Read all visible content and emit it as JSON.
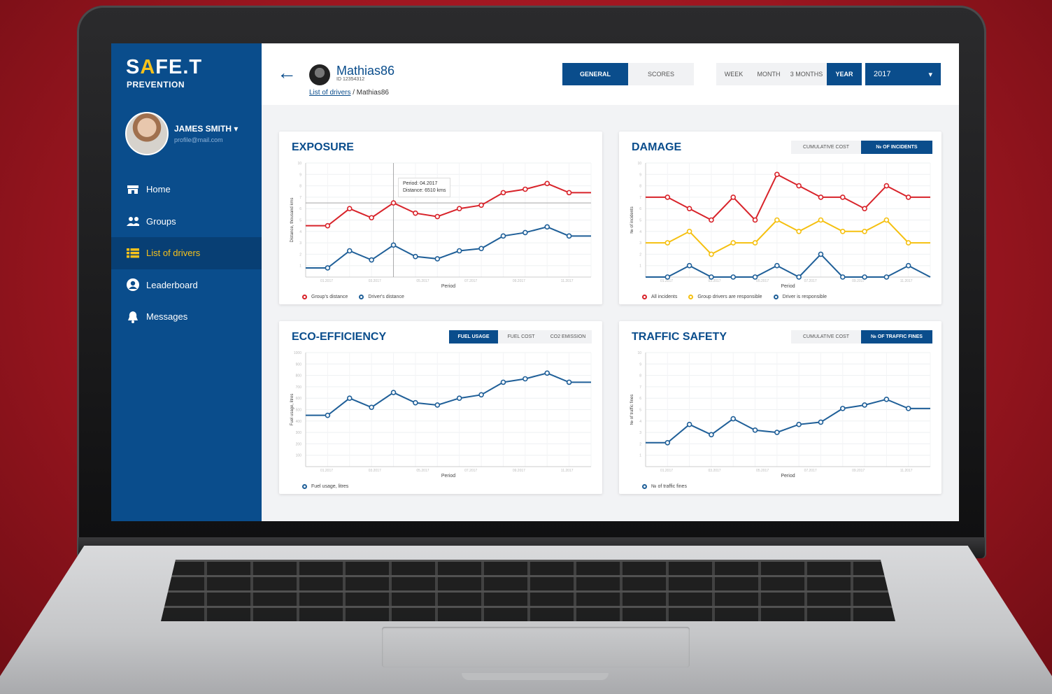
{
  "brand": {
    "logo_pre": "S",
    "logo_accent": "A",
    "logo_post": "FE.T",
    "subtitle": "PREVENTION"
  },
  "user": {
    "name": "JAMES SMITH ▾",
    "email": "profile@mail.com"
  },
  "nav": [
    {
      "label": "Home",
      "icon": "home-icon"
    },
    {
      "label": "Groups",
      "icon": "groups-icon"
    },
    {
      "label": "List of drivers",
      "icon": "list-icon",
      "active": true
    },
    {
      "label": "Leaderboard",
      "icon": "user-circle-icon"
    },
    {
      "label": "Messages",
      "icon": "bell-icon"
    }
  ],
  "header": {
    "back_icon": "←",
    "driver_name": "Mathias86",
    "driver_id": "ID 12354312",
    "breadcrumb_link": "List of drivers",
    "breadcrumb_current": " / Mathias86",
    "view_tabs": [
      "GENERAL",
      "SCORES"
    ],
    "period_tabs": [
      "WEEK",
      "MONTH",
      "3 MONTHS",
      "YEAR"
    ],
    "year": "2017",
    "year_caret": "▾"
  },
  "colors": {
    "primary": "#0a4d8c",
    "accent": "#f6c21c",
    "red": "#d8232a",
    "yellow": "#f5c010",
    "blue": "#1f5f98"
  },
  "charts": {
    "exposure": {
      "title": "EXPOSURE",
      "ylabel": "Distance, thousand kms",
      "xlabel": "Period",
      "legend": [
        "Group's distance",
        "Driver's distance"
      ],
      "tooltip_period": "Period: 04.2017",
      "tooltip_distance": "Distance: 6510 kms"
    },
    "damage": {
      "title": "DAMAGE",
      "tabs": [
        "CUMULATIVE COST",
        "№ OF INCIDENTS"
      ],
      "ylabel": "№ of incidents",
      "xlabel": "Period",
      "legend": [
        "All incidents",
        "Group drivers are responsible",
        "Driver is responsible"
      ]
    },
    "eco": {
      "title": "ECO-EFFICIENCY",
      "tabs": [
        "FUEL USAGE",
        "FUEL COST",
        "CO2 EMISSION"
      ],
      "ylabel": "Fuel usage, litres",
      "xlabel": "Period",
      "legend": [
        "Fuel usage, litres"
      ]
    },
    "traffic": {
      "title": "TRAFFIC SAFETY",
      "tabs": [
        "CUMULATIVE COST",
        "№ OF TRAFFIC FINES"
      ],
      "ylabel": "№ of traffic fines",
      "xlabel": "Period",
      "legend": [
        "№ of traffic fines"
      ]
    }
  },
  "chart_data": [
    {
      "type": "line",
      "title": "EXPOSURE",
      "xlabel": "Period",
      "ylabel": "Distance, thousand kms",
      "ylim": [
        0,
        10
      ],
      "yticks": [
        1,
        2,
        3,
        4,
        5,
        6,
        7,
        8,
        9,
        10
      ],
      "x": [
        "01.2017",
        "",
        "03.2017",
        "",
        "05.2017",
        "",
        "07.2017",
        "",
        "09.2017",
        "",
        "11.2017",
        ""
      ],
      "series": [
        {
          "name": "Group's distance",
          "color": "#d8232a",
          "values": [
            4.5,
            4.5,
            6.0,
            5.2,
            6.5,
            5.6,
            5.3,
            6.0,
            6.3,
            7.4,
            7.7,
            8.2,
            7.4,
            7.4
          ]
        },
        {
          "name": "Driver's distance",
          "color": "#1f5f98",
          "values": [
            0.8,
            0.8,
            2.3,
            1.5,
            2.8,
            1.8,
            1.6,
            2.3,
            2.5,
            3.6,
            3.9,
            4.4,
            3.6,
            3.6
          ]
        }
      ]
    },
    {
      "type": "line",
      "title": "DAMAGE",
      "xlabel": "Period",
      "ylabel": "№ of incidents",
      "ylim": [
        0,
        10
      ],
      "yticks": [
        1,
        2,
        3,
        4,
        5,
        6,
        7,
        8,
        9,
        10
      ],
      "x": [
        "01.2017",
        "",
        "03.2017",
        "",
        "05.2017",
        "",
        "07.2017",
        "",
        "09.2017",
        "",
        "11.2017",
        ""
      ],
      "series": [
        {
          "name": "All incidents",
          "color": "#d8232a",
          "values": [
            7,
            7,
            6,
            5,
            7,
            5,
            9,
            8,
            7,
            7,
            6,
            8,
            7,
            7
          ]
        },
        {
          "name": "Group drivers are responsible",
          "color": "#f5c010",
          "values": [
            3,
            3,
            4,
            2,
            3,
            3,
            5,
            4,
            5,
            4,
            4,
            5,
            3,
            3
          ]
        },
        {
          "name": "Driver is responsible",
          "color": "#1f5f98",
          "values": [
            0,
            0,
            1,
            0,
            0,
            0,
            1,
            0,
            2,
            0,
            0,
            0,
            1,
            0
          ]
        }
      ]
    },
    {
      "type": "line",
      "title": "ECO-EFFICIENCY",
      "xlabel": "Period",
      "ylabel": "Fuel usage, litres",
      "ylim": [
        0,
        1000
      ],
      "yticks": [
        100,
        200,
        300,
        400,
        500,
        600,
        700,
        800,
        900,
        1000
      ],
      "x": [
        "01.2017",
        "",
        "03.2017",
        "",
        "05.2017",
        "",
        "07.2017",
        "",
        "09.2017",
        "",
        "11.2017",
        ""
      ],
      "series": [
        {
          "name": "Fuel usage, litres",
          "color": "#1f5f98",
          "values": [
            450,
            450,
            600,
            520,
            650,
            560,
            540,
            600,
            630,
            740,
            770,
            820,
            740,
            740
          ]
        }
      ]
    },
    {
      "type": "line",
      "title": "TRAFFIC SAFETY",
      "xlabel": "Period",
      "ylabel": "№ of traffic fines",
      "ylim": [
        0,
        10
      ],
      "yticks": [
        1,
        2,
        3,
        4,
        5,
        6,
        7,
        8,
        9,
        10
      ],
      "x": [
        "01.2017",
        "",
        "03.2017",
        "",
        "05.2017",
        "",
        "07.2017",
        "",
        "09.2017",
        "",
        "11.2017",
        ""
      ],
      "series": [
        {
          "name": "№ of traffic fines",
          "color": "#1f5f98",
          "values": [
            2.1,
            2.1,
            3.7,
            2.8,
            4.2,
            3.2,
            3.0,
            3.7,
            3.9,
            5.1,
            5.4,
            5.9,
            5.1,
            5.1
          ]
        }
      ]
    }
  ]
}
